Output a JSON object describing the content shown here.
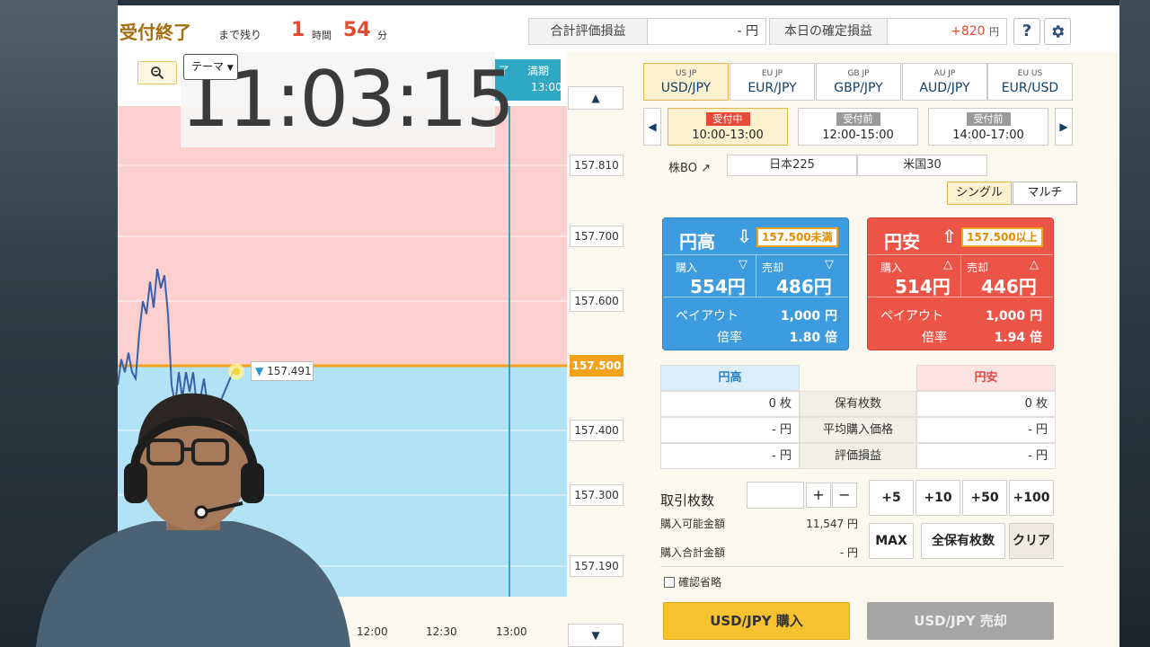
{
  "header": {
    "status": "受付終了",
    "remaining_label": "まで残り",
    "hours": "1",
    "hours_unit": "時間",
    "minutes": "54",
    "minutes_unit": "分",
    "unrealized_label": "合計評価損益",
    "unrealized_value": "- 円",
    "realized_label": "本日の確定損益",
    "realized_value": "+820",
    "realized_unit": "円",
    "help_label": "?",
    "realized_color": "#e64a2e"
  },
  "chart": {
    "theme_label": "テーマ",
    "clock": "11:03:15",
    "expiry_left": "了",
    "expiry_label": "満期",
    "expiry_time": "13:00",
    "current_price_callout": "157.491",
    "ticks": [
      "157.810",
      "157.700",
      "157.600",
      "157.500",
      "157.400",
      "157.300",
      "157.190"
    ],
    "current_tick": "157.500",
    "time_labels": [
      "12:00",
      "12:30",
      "13:00"
    ],
    "colors": {
      "above": "#fdd0d0",
      "below": "#b2e2f6",
      "strike_line": "#f5a21b",
      "series": "#3b5fa8",
      "expiry_line": "#2fa8c3"
    },
    "series": [
      [
        0,
        157.47
      ],
      [
        4,
        157.51
      ],
      [
        8,
        157.49
      ],
      [
        12,
        157.52
      ],
      [
        16,
        157.49
      ],
      [
        20,
        157.48
      ],
      [
        24,
        157.55
      ],
      [
        28,
        157.6
      ],
      [
        32,
        157.58
      ],
      [
        36,
        157.63
      ],
      [
        40,
        157.59
      ],
      [
        44,
        157.65
      ],
      [
        48,
        157.62
      ],
      [
        52,
        157.64
      ],
      [
        56,
        157.58
      ],
      [
        60,
        157.47
      ],
      [
        64,
        157.44
      ],
      [
        68,
        157.49
      ],
      [
        72,
        157.45
      ],
      [
        76,
        157.49
      ],
      [
        80,
        157.46
      ],
      [
        84,
        157.49
      ],
      [
        88,
        157.44
      ],
      [
        92,
        157.45
      ],
      [
        96,
        157.48
      ],
      [
        100,
        157.44
      ],
      [
        108,
        157.43
      ],
      [
        116,
        157.45
      ],
      [
        122,
        157.47
      ],
      [
        128,
        157.49
      ],
      [
        132,
        157.491
      ]
    ]
  },
  "pairs": [
    {
      "name": "USD/JPY",
      "flags": "US JP",
      "active": true
    },
    {
      "name": "EUR/JPY",
      "flags": "EU JP",
      "active": false
    },
    {
      "name": "GBP/JPY",
      "flags": "GB JP",
      "active": false
    },
    {
      "name": "AUD/JPY",
      "flags": "AU JP",
      "active": false
    },
    {
      "name": "EUR/USD",
      "flags": "EU US",
      "active": false
    }
  ],
  "sessions": [
    {
      "badge": "受付中",
      "range": "10:00-13:00",
      "active": true
    },
    {
      "badge": "受付前",
      "range": "12:00-15:00",
      "active": false
    },
    {
      "badge": "受付前",
      "range": "14:00-17:00",
      "active": false
    }
  ],
  "stock": {
    "label": "株BO",
    "items": [
      "日本225",
      "米国30"
    ]
  },
  "modes": [
    "シングル",
    "マルチ"
  ],
  "yen_up": {
    "title": "円高",
    "condition": "157.500未満",
    "buy_label": "購入",
    "sell_label": "売却",
    "buy_price": "554円",
    "sell_price": "486円",
    "payout_label": "ペイアウト",
    "payout_value": "1,000 円",
    "rate_label": "倍率",
    "rate_value": "1.80 倍"
  },
  "yen_down": {
    "title": "円安",
    "condition": "157.500以上",
    "buy_label": "購入",
    "sell_label": "売却",
    "buy_price": "514円",
    "sell_price": "446円",
    "payout_label": "ペイアウト",
    "payout_value": "1,000 円",
    "rate_label": "倍率",
    "rate_value": "1.94 倍"
  },
  "positions": {
    "up_header": "円高",
    "down_header": "円安",
    "rows": [
      {
        "label": "保有枚数",
        "up": "0 枚",
        "down": "0 枚"
      },
      {
        "label": "平均購入価格",
        "up": "- 円",
        "down": "- 円"
      },
      {
        "label": "評価損益",
        "up": "- 円",
        "down": "- 円"
      }
    ]
  },
  "order": {
    "qty_label": "取引枚数",
    "qty_value": "",
    "plus": "+",
    "minus": "−",
    "quick": [
      "+5",
      "+10",
      "+50",
      "+100"
    ],
    "max_label": "MAX",
    "all_label": "全保有枚数",
    "clear_label": "クリア",
    "available_label": "購入可能金額",
    "available_value": "11,547 円",
    "total_label": "購入合計金額",
    "total_value": "- 円",
    "skip_confirm_label": "確認省略",
    "buy_button": "USD/JPY 購入",
    "sell_button": "USD/JPY 売却"
  }
}
